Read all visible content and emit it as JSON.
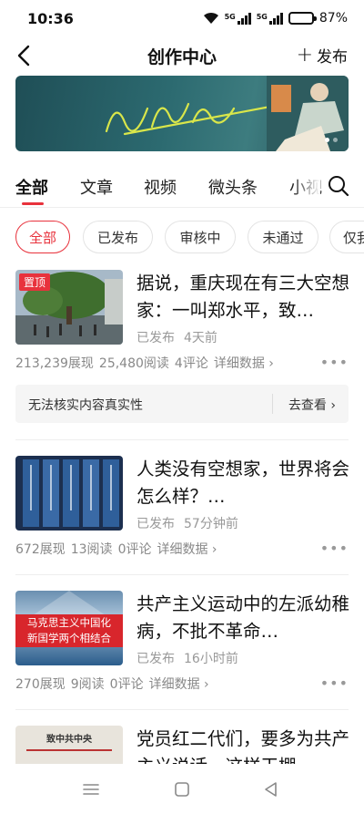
{
  "status_bar": {
    "time": "10:36",
    "signal1_label": "5G",
    "signal2_label": "5G",
    "battery": "87%",
    "battery_level": 0.87
  },
  "nav": {
    "title": "创作中心",
    "publish_label": "发布"
  },
  "tabs": [
    "全部",
    "文章",
    "视频",
    "微头条",
    "小视"
  ],
  "filters": [
    "全部",
    "已发布",
    "审核中",
    "未通过",
    "仅我"
  ],
  "articles": [
    {
      "title": "据说，重庆现在有三大空想家：一叫郑水平，致…",
      "badge": "置顶",
      "status": "已发布",
      "time": "4天前",
      "views": "213,239展现",
      "reads": "25,480阅读",
      "comments": "4评论",
      "detail": "详细数据 ›",
      "notice": "无法核实内容真实性",
      "notice_action": "去查看 ›"
    },
    {
      "title": "人类没有空想家，世界将会怎么样？…",
      "status": "已发布",
      "time": "57分钟前",
      "views": "672展现",
      "reads": "13阅读",
      "comments": "0评论",
      "detail": "详细数据 ›"
    },
    {
      "title": "共产主义运动中的左派幼稚病，不批不革命…",
      "status": "已发布",
      "time": "16小时前",
      "views": "270展现",
      "reads": "9阅读",
      "comments": "0评论",
      "detail": "详细数据 ›",
      "thumb_text_1": "马克思主义中国化",
      "thumb_text_2": "新国学两个相结合"
    },
    {
      "title": "党员红二代们，要多为共产主义说话，这样干棚…",
      "thumb_text_1": "致中共中央"
    }
  ],
  "colors": {
    "accent": "#e8323c",
    "muted": "#999999"
  }
}
